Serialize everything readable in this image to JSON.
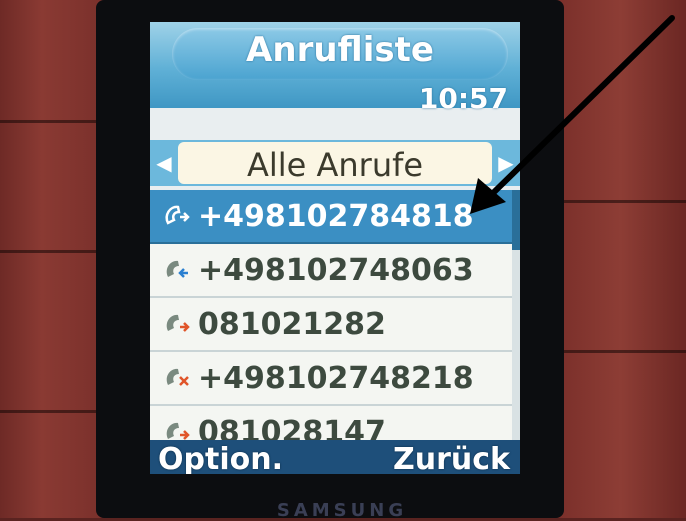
{
  "screen": {
    "title": "Anrufliste",
    "clock": "10:57",
    "filter_tab": "Alle Anrufe",
    "calls": [
      {
        "number": "+498102784818",
        "type": "dialed-icon",
        "selected": true
      },
      {
        "number": "+498102748063",
        "type": "received-icon",
        "selected": false
      },
      {
        "number": "081021282",
        "type": "dialed-icon",
        "selected": false
      },
      {
        "number": "+498102748218",
        "type": "missed-icon",
        "selected": false
      },
      {
        "number": "081028147",
        "type": "dialed-icon",
        "selected": false
      }
    ],
    "softkey_left": "Option.",
    "softkey_right": "Zurück"
  },
  "phone": {
    "brand": "SAMSUNG"
  },
  "colors": {
    "screen_blue": "#3b8fc3",
    "softkey_bar": "#1e4f7a",
    "list_bg": "#f4f6f2",
    "annotation_arrow": "#000000"
  }
}
